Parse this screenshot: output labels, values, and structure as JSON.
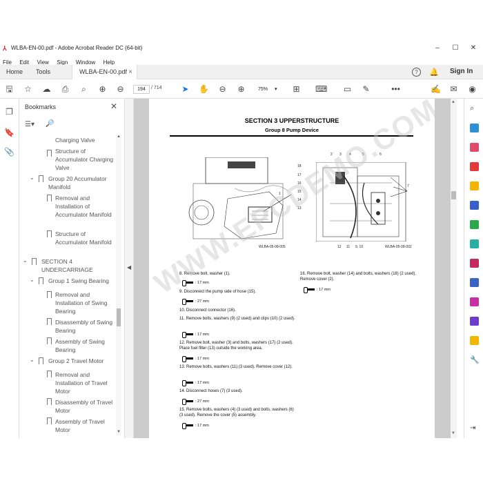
{
  "window": {
    "title": "WLBA-EN-00.pdf - Adobe Acrobat Reader DC (64-bit)",
    "minimize": "–",
    "maximize": "☐",
    "close": "✕"
  },
  "menu": [
    "File",
    "Edit",
    "View",
    "Sign",
    "Window",
    "Help"
  ],
  "tabs": {
    "home": "Home",
    "tools": "Tools",
    "document": "WLBA-EN-00.pdf",
    "close": "×"
  },
  "header": {
    "help": "?",
    "sign_in": "Sign In"
  },
  "toolbar": {
    "page_current": "194",
    "page_total": "/ 714",
    "zoom": "75%",
    "more": "•••"
  },
  "bookmarks": {
    "title": "Bookmarks",
    "close": "✕",
    "items": [
      {
        "label": "Charging Valve",
        "level": 3
      },
      {
        "label": "Structure of Accumulator Charging Valve",
        "level": 3
      },
      {
        "label": "Group 20 Accumulator Manifold",
        "level": 2
      },
      {
        "label": "Removal and Installation of Accumulator Manifold",
        "level": 3
      },
      {
        "label": "Structure of Accumulator Manifold",
        "level": 3
      },
      {
        "label": "SECTION 4 UNDERCARRIAGE",
        "level": 1
      },
      {
        "label": "Group 1 Swing Bearing",
        "level": 2
      },
      {
        "label": "Removal and Installation of Swing Bearing",
        "level": 3
      },
      {
        "label": "Disassembly of Swing Bearing",
        "level": 3
      },
      {
        "label": "Assembly of Swing Bearing",
        "level": 3
      },
      {
        "label": "Group 2 Travel Motor",
        "level": 2
      },
      {
        "label": "Removal and Installation of Travel Motor",
        "level": 3
      },
      {
        "label": "Disassembly of Travel Motor",
        "level": 3
      },
      {
        "label": "Assembly of Travel Motor",
        "level": 3
      }
    ]
  },
  "document": {
    "section_title": "SECTION 3 UPPERSTRUCTURE",
    "group_title": "Group 8 Pump Device",
    "fig1_caption": "WLBA-05-08-005",
    "fig2_caption": "WLBA-05-08-002",
    "fig1_labels": [
      "1"
    ],
    "fig2_labels": [
      "2",
      "3",
      "4",
      "5",
      "6",
      "18",
      "17",
      "16",
      "15",
      "14",
      "13",
      "7",
      "12",
      "11",
      "9, 10"
    ],
    "steps_left": [
      {
        "text": "8.   Remove bolt, washer (1).",
        "torque": ": 17 mm"
      },
      {
        "text": "9.   Disconnect the pump side of hose (15).",
        "torque": ": 27 mm"
      },
      {
        "text": "10.  Disconnect connector (16).",
        "torque": ""
      },
      {
        "text": "11.  Remove bolts, washers (9) (2 used) and clips (10) (2 used).",
        "torque": ": 17 mm"
      },
      {
        "text": "12.  Remove bolt, washer (3) and bolts, washers (17) (2 used). Place fuel filter (13) outside the working area.",
        "torque": ": 17 mm"
      },
      {
        "text": "13.  Remove bolts, washers (11) (3 used). Remove cover (12).",
        "torque": ": 17 mm"
      },
      {
        "text": "14.  Disconnect hoses (7) (3 used).",
        "torque": ": 27 mm"
      },
      {
        "text": "15.  Remove bolts, washers (4) (3 used) and bolts, washers (6) (3 used). Remove the cover (5) assembly.",
        "torque": ": 17 mm"
      }
    ],
    "steps_right": [
      {
        "text": "16.  Remove bolt, washer (14) and bolts, washers (18) (2 used). Remove cover (2).",
        "torque": ": 17 mm"
      }
    ]
  },
  "watermark": "WWW.EPCDEMO.COM",
  "colors": {
    "accent_blue": "#1473e6",
    "pdf_red": "#d0202a"
  }
}
